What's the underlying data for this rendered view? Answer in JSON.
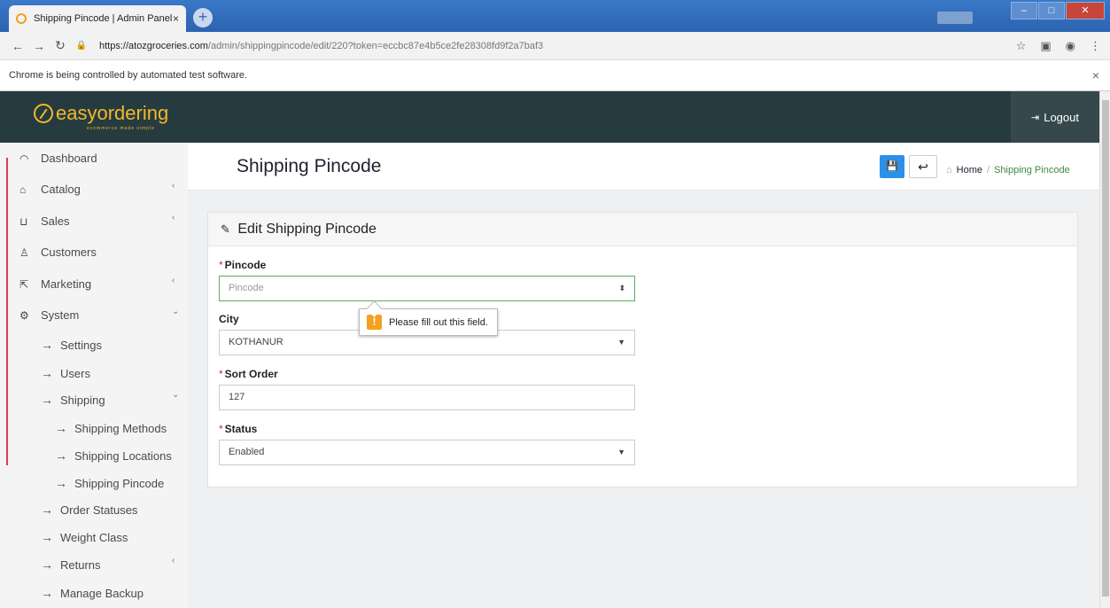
{
  "browser": {
    "tab_title": "Shipping Pincode | Admin Panel",
    "tab_close": "×",
    "new_tab": "+",
    "url_host": "https://atozgroceries.com",
    "url_path": "/admin/shippingpincode/edit/220?token=eccbc87e4b5ce2fe28308fd9f2a7baf3",
    "infobar_text": "Chrome is being controlled by automated test software.",
    "infobar_close": "×"
  },
  "header": {
    "logo_text": "easyordering",
    "logo_tagline": "ecommerce made simple",
    "logout_label": "Logout"
  },
  "sidebar": {
    "items": [
      {
        "label": "Dashboard",
        "icon": "dashboard-icon"
      },
      {
        "label": "Catalog",
        "icon": "tag-icon"
      },
      {
        "label": "Sales",
        "icon": "cart-icon"
      },
      {
        "label": "Customers",
        "icon": "user-icon"
      },
      {
        "label": "Marketing",
        "icon": "share-icon"
      },
      {
        "label": "System",
        "icon": "cog-icon"
      }
    ],
    "system_sub": [
      "Settings",
      "Users",
      "Shipping",
      "Order Statuses",
      "Weight Class",
      "Returns",
      "Manage Backup"
    ],
    "shipping_sub": [
      "Shipping Methods",
      "Shipping Locations",
      "Shipping Pincode"
    ]
  },
  "page": {
    "title": "Shipping Pincode",
    "breadcrumb_home": "Home",
    "breadcrumb_sep": "/",
    "breadcrumb_current": "Shipping Pincode"
  },
  "form": {
    "panel_title": "Edit Shipping Pincode",
    "pincode_label": "Pincode",
    "pincode_placeholder": "Pincode",
    "city_label": "City",
    "city_value": "KOTHANUR",
    "sort_label": "Sort Order",
    "sort_value": "127",
    "status_label": "Status",
    "status_value": "Enabled",
    "required_mark": "*",
    "validation_message": "Please fill out this field.",
    "validation_icon": "!"
  },
  "colors": {
    "header_bg": "#263b40",
    "logo": "#f3b82a",
    "accent_blue": "#2d8fe8",
    "active_green": "#3b8c3b",
    "required_red": "#dd2222"
  }
}
